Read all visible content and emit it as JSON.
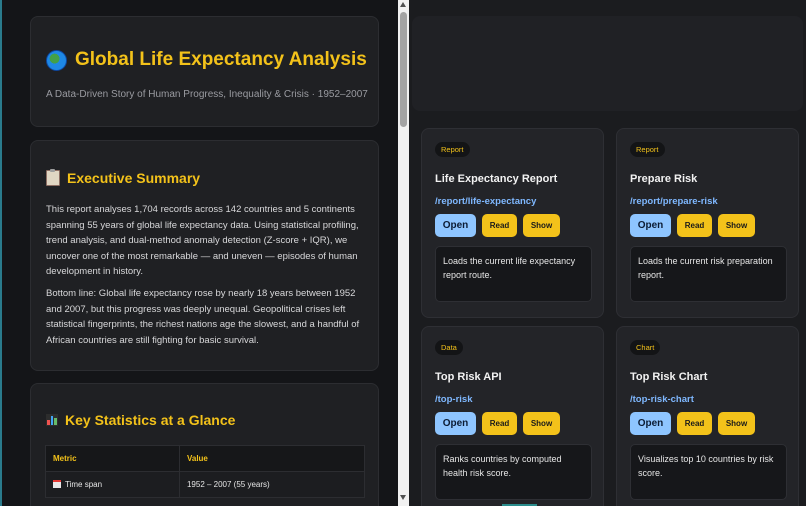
{
  "report": {
    "title": "Global Life Expectancy Analysis",
    "subtitle": "A Data-Driven Story of Human Progress, Inequality & Crisis · 1952–2007",
    "title_icon": "globe-icon"
  },
  "summary": {
    "heading": "Executive Summary",
    "heading_icon": "clipboard-icon",
    "paragraph1": "This report analyses 1,704 records across 142 countries and 5 continents spanning 55 years of global life expectancy data. Using statistical profiling, trend analysis, and dual-method anomaly detection (Z-score + IQR), we uncover one of the most remarkable — and uneven — episodes of human development in history.",
    "paragraph2": "Bottom line: Global life expectancy rose by nearly 18 years between 1952 and 2007, but this progress was deeply unequal. Geopolitical crises left statistical fingerprints, the richest nations age the slowest, and a handful of African countries are still fighting for basic survival."
  },
  "stats": {
    "heading": "Key Statistics at a Glance",
    "heading_icon": "bar-chart-icon",
    "columns": [
      "Metric",
      "Value"
    ],
    "rows": [
      {
        "metric": "Time span",
        "value": "1952 – 2007 (55 years)",
        "icon": "calendar-icon"
      }
    ]
  },
  "routes": [
    {
      "badge": "Report",
      "title": "Life Expectancy Report",
      "path": "/report/life-expectancy",
      "open": "Open",
      "read": "Read",
      "show": "Show",
      "description": "Loads the current life expectancy report route."
    },
    {
      "badge": "Report",
      "title": "Prepare Risk",
      "path": "/report/prepare-risk",
      "open": "Open",
      "read": "Read",
      "show": "Show",
      "description": "Loads the current risk preparation report."
    },
    {
      "badge": "Data",
      "title": "Top Risk API",
      "path": "/top-risk",
      "open": "Open",
      "read": "Read",
      "show": "Show",
      "description": "Ranks countries by computed health risk score."
    },
    {
      "badge": "Chart",
      "title": "Top Risk Chart",
      "path": "/top-risk-chart",
      "open": "Open",
      "read": "Read",
      "show": "Show",
      "description": "Visualizes top 10 countries by risk score."
    }
  ],
  "colors": {
    "accent": "#f3c21a",
    "link": "#7fb8ff",
    "open_button": "#8ec5ff"
  }
}
